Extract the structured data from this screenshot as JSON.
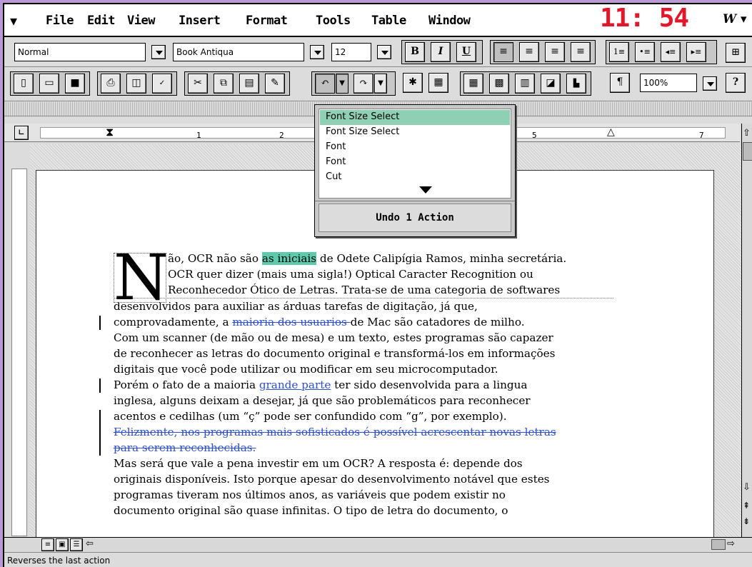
{
  "menubar": {
    "items": [
      "File",
      "Edit",
      "View",
      "Insert",
      "Format",
      "Tools",
      "Table",
      "Window"
    ],
    "clock": "11: 54",
    "app_icon": "W"
  },
  "formatting": {
    "style": "Normal",
    "font": "Book Antiqua",
    "size": "12",
    "bold": "B",
    "italic": "I",
    "underline": "U"
  },
  "standard": {
    "zoom": "100%",
    "pilcrow": "¶",
    "help": "?"
  },
  "undo_popup": {
    "items": [
      "Font Size Select",
      "Font Size Select",
      "Font",
      "Font",
      "Cut"
    ],
    "selected_index": 0,
    "summary": "Undo 1 Action"
  },
  "ruler": {
    "numbers": [
      "1",
      "2",
      "5",
      "7"
    ]
  },
  "document": {
    "dropcap": "N",
    "l1a": "ão, OCR não são ",
    "l1hl": "as iniciais",
    "l1b": " de Odete Calipígia Ramos, minha secretária.",
    "l2": "OCR quer dizer (mais uma sigla!) Optical Caracter Recognition ou",
    "l3": "Reconhecedor Ótico de Letras. Trata-se de uma categoria de softwares",
    "l4": "desenvolvidos para auxiliar as árduas tarefas de digitação, já que,",
    "l5a": "comprovadamente, a ",
    "l5s": "maioria dos usuarios ",
    "l5b": "de Mac são catadores de milho.",
    "l6": "Com um scanner (de mão ou de mesa) e um texto, estes programas são capazer",
    "l7": "de reconhecer as letras do documento original e transformá-los em informações",
    "l8": "digitais que você pode utilizar ou modificar em seu microcomputador.",
    "l9a": "Porém o fato de a maioria ",
    "l9l": "grande parte",
    "l9b": " ter sido desenvolvida para a lingua",
    "l10": "inglesa, alguns deixam a desejar, já que são problemáticos para reconhecer",
    "l11": "acentos e cedilhas (um “ç” pode ser confundido com “g”, por exemplo).",
    "l12": "Felizmente, nos programas mais sofisticados é possível acrescentar novas letras",
    "l13": "para serem reconhecidas. ",
    "l14": "Mas será que vale a pena investir em um OCR? A resposta é: depende dos",
    "l15": "originais disponíveis. Isto porque apesar do desenvolvimento notável que estes",
    "l16": "programas tiveram nos últimos anos, as variáveis que podem existir no",
    "l17": "documento original são quase infinitas. O tipo de letra do documento, o"
  },
  "status": {
    "text": "Reverses the last action"
  },
  "colors": {
    "desktop": "#b99ad4",
    "clock": "#e3172a",
    "highlight": "#5dcaae",
    "revision": "#2e4fd0",
    "selection": "#8fcfb4"
  }
}
